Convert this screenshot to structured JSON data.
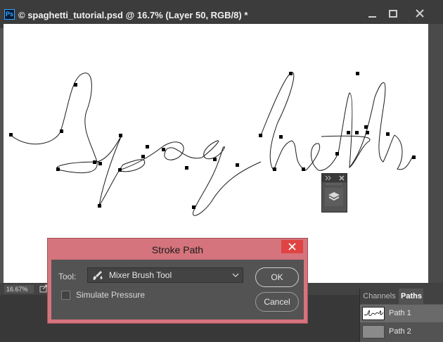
{
  "window": {
    "app_badge": "Ps",
    "title": "© spaghetti_tutorial.psd @ 16.7% (Layer 50, RGB/8) *",
    "buttons": [
      "minimize-icon",
      "restore-icon",
      "close-icon"
    ]
  },
  "status": {
    "zoom": "16.67%"
  },
  "canvas": {
    "artwork_text": "Spaghetti",
    "background": "#ffffff"
  },
  "dialog": {
    "title": "Stroke Path",
    "tool_label": "Tool:",
    "tool_value": "Mixer Brush Tool",
    "simulate_pressure_label": "Simulate Pressure",
    "simulate_pressure_checked": false,
    "ok_label": "OK",
    "cancel_label": "Cancel",
    "title_bar_color": "#d5747c",
    "close_color": "#e04343"
  },
  "panel": {
    "tabs": [
      {
        "label": "Channels",
        "active": false
      },
      {
        "label": "Paths",
        "active": true
      }
    ],
    "items": [
      {
        "label": "Path 1",
        "selected": true
      },
      {
        "label": "Path 2",
        "selected": false
      }
    ]
  },
  "layers_mini_panel": {
    "icon": "layers-icon"
  }
}
